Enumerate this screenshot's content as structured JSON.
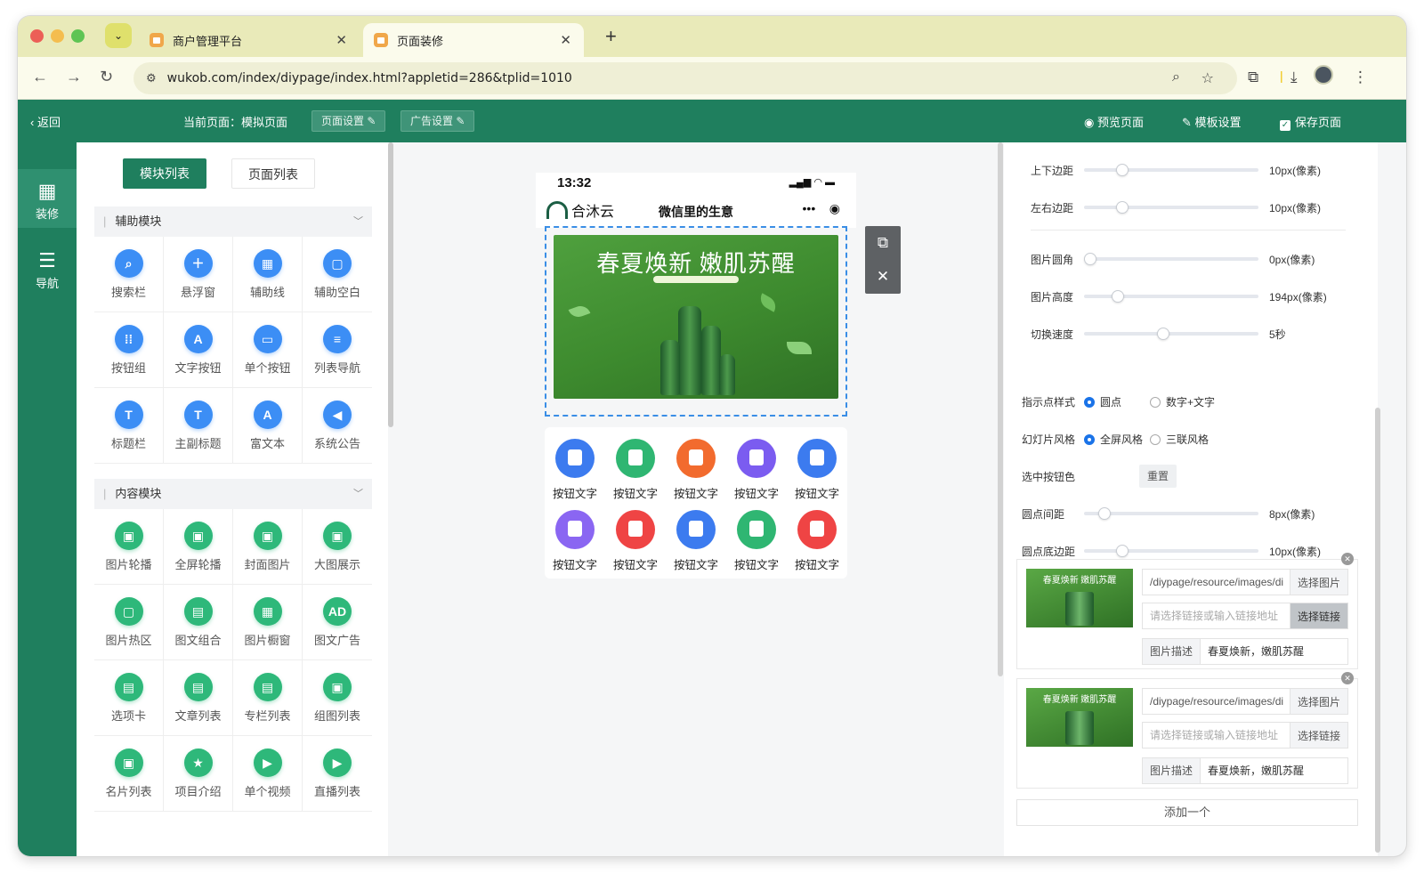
{
  "browser": {
    "tabs": [
      {
        "title": "商户管理平台"
      },
      {
        "title": "页面装修"
      }
    ],
    "url": "wukob.com/index/diypage/index.html?appletid=286&tplid=1010"
  },
  "header": {
    "back": "返回",
    "current_page": "当前页面：模拟页面",
    "page_settings": "页面设置",
    "ad_settings": "广告设置",
    "preview": "预览页面",
    "template_settings": "模板设置",
    "save": "保存页面"
  },
  "rail": [
    {
      "label": "装修",
      "icon": "grid-icon"
    },
    {
      "label": "导航",
      "icon": "list-icon"
    }
  ],
  "panel": {
    "tab_modules": "模块列表",
    "tab_pages": "页面列表",
    "group_aux": "辅助模块",
    "group_content": "内容模块",
    "aux_items": [
      "搜索栏",
      "悬浮窗",
      "辅助线",
      "辅助空白",
      "按钮组",
      "文字按钮",
      "单个按钮",
      "列表导航",
      "标题栏",
      "主副标题",
      "富文本",
      "系统公告"
    ],
    "content_items": [
      "图片轮播",
      "全屏轮播",
      "封面图片",
      "大图展示",
      "图片热区",
      "图文组合",
      "图片橱窗",
      "图文广告",
      "选项卡",
      "文章列表",
      "专栏列表",
      "组图列表",
      "名片列表",
      "项目介绍",
      "单个视频",
      "直播列表"
    ]
  },
  "phone": {
    "time": "13:32",
    "brand": "合沐云",
    "title": "微信里的生意",
    "banner_text": "春夏焕新 嫩肌苏醒",
    "nav_label": "按钮文字"
  },
  "settings": {
    "rows": [
      {
        "label": "上下边距",
        "value": "10px(像素)",
        "level": 0.2
      },
      {
        "label": "左右边距",
        "value": "10px(像素)",
        "level": 0.2
      },
      {
        "label": "图片圆角",
        "value": "0px(像素)",
        "level": 0.0
      },
      {
        "label": "图片高度",
        "value": "194px(像素)",
        "level": 0.17
      },
      {
        "label": "切换速度",
        "value": "5秒",
        "level": 0.45
      }
    ],
    "indicator_label": "指示点样式",
    "indicator_opt1": "圆点",
    "indicator_opt2": "数字+文字",
    "slide_label": "幻灯片风格",
    "slide_opt1": "全屏风格",
    "slide_opt2": "三联风格",
    "selected_color_label": "选中按钮色",
    "reset": "重置",
    "rows2": [
      {
        "label": "圆点间距",
        "value": "8px(像素)",
        "level": 0.09
      },
      {
        "label": "圆点底边距",
        "value": "10px(像素)",
        "level": 0.2
      }
    ],
    "items": [
      {
        "image_path": "/diypage/resource/images/di",
        "choose_image": "选择图片",
        "link_placeholder": "请选择链接或输入链接地址",
        "choose_link": "选择链接",
        "desc_label": "图片描述",
        "desc": "春夏焕新，嫩肌苏醒",
        "thumb_text": "春夏焕新 嫩肌苏醒"
      },
      {
        "image_path": "/diypage/resource/images/di",
        "choose_image": "选择图片",
        "link_placeholder": "请选择链接或输入链接地址",
        "choose_link": "选择链接",
        "desc_label": "图片描述",
        "desc": "春夏焕新，嫩肌苏醒",
        "thumb_text": "春夏焕新 嫩肌苏醒"
      }
    ],
    "add_one": "添加一个"
  },
  "colors": {
    "brand_green": "#1f7f5e",
    "module_blue": "#3c8ef5",
    "module_green": "#2eb87a",
    "nav_icons": [
      "#3c7bef",
      "#2fb672",
      "#f26b2e",
      "#7b5cf0",
      "#3c7bef",
      "#8a66f2",
      "#ef4444",
      "#3c7bef",
      "#2fb672",
      "#ef4444"
    ]
  }
}
